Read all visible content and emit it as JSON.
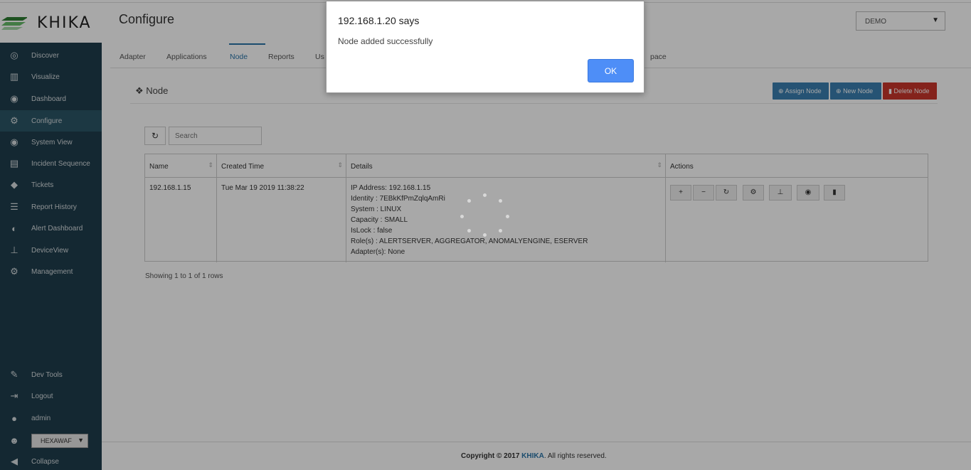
{
  "header": {
    "logo_text": "KHIKA",
    "page_title": "Configure",
    "tenant_select": "DEMO"
  },
  "sidebar": {
    "items": [
      {
        "label": "Discover",
        "icon": "compass-icon"
      },
      {
        "label": "Visualize",
        "icon": "bar-chart-icon"
      },
      {
        "label": "Dashboard",
        "icon": "dashboard-icon"
      },
      {
        "label": "Configure",
        "icon": "gears-icon"
      },
      {
        "label": "System View",
        "icon": "eye-icon"
      },
      {
        "label": "Incident Sequence",
        "icon": "map-icon"
      },
      {
        "label": "Tickets",
        "icon": "tag-icon"
      },
      {
        "label": "Report History",
        "icon": "list-icon"
      },
      {
        "label": "Alert Dashboard",
        "icon": "tachometer-icon"
      },
      {
        "label": "DeviceView",
        "icon": "sitemap-icon"
      },
      {
        "label": "Management",
        "icon": "cog-icon"
      }
    ],
    "bottom_items": [
      {
        "label": "Dev Tools",
        "icon": "wrench-icon"
      },
      {
        "label": "Logout",
        "icon": "sign-out-icon"
      },
      {
        "label": "admin",
        "icon": "user-icon"
      }
    ],
    "tenant_mini": "HEXAWAF",
    "collapse_label": "Collapse"
  },
  "tabs": [
    {
      "label": "Adapter"
    },
    {
      "label": "Applications"
    },
    {
      "label": "Node"
    },
    {
      "label": "Reports"
    },
    {
      "label": "Us"
    },
    {
      "label": "pace"
    }
  ],
  "section": {
    "title": "Node",
    "assign_label": "Assign Node",
    "new_label": "New Node",
    "delete_label": "Delete Node"
  },
  "search": {
    "placeholder": "Search"
  },
  "table": {
    "columns": [
      "Name",
      "Created Time",
      "Details",
      "Actions"
    ],
    "row": {
      "name": "192.168.1.15",
      "created": "Tue Mar 19 2019 11:38:22",
      "details": [
        "IP Address: 192.168.1.15",
        "Identity : 7EBkKfPmZqlqAmRi",
        "System : LINUX",
        "Capacity : SMALL",
        "IsLock : false",
        "Role(s) : ALERTSERVER, AGGREGATOR, ANOMALYENGINE, ESERVER",
        "Adapter(s): None"
      ]
    }
  },
  "showing_text": "Showing 1 to 1 of 1 rows",
  "footer": {
    "copyright": "Copyright © 2017",
    "brand": "KHIKA",
    "rights": ". All rights reserved."
  },
  "dialog": {
    "title": "192.168.1.20 says",
    "message": "Node added successfully",
    "ok_label": "OK"
  }
}
